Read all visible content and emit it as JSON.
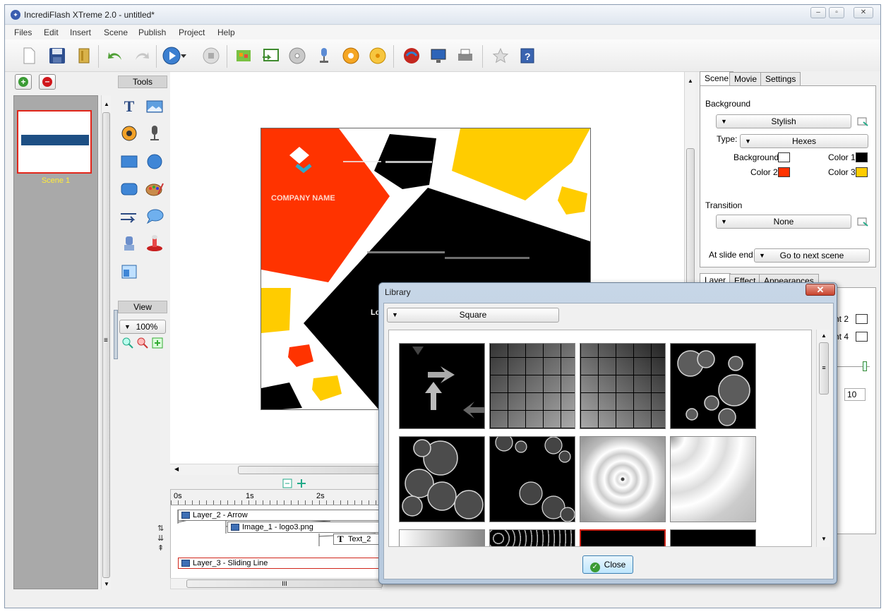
{
  "window": {
    "title": "IncrediFlash XTreme 2.0 - untitled*"
  },
  "menu": [
    "Files",
    "Edit",
    "Insert",
    "Scene",
    "Publish",
    "Project",
    "Help"
  ],
  "scenes": {
    "items": [
      {
        "label": "Scene 1"
      }
    ]
  },
  "tools": {
    "header": "Tools",
    "view_header": "View",
    "zoom": "100%"
  },
  "stage": {
    "company_name": "COMPANY NAME",
    "text_fragment": "Lo"
  },
  "timeline": {
    "ticks": [
      "0s",
      "1s",
      "2s"
    ],
    "layers": [
      {
        "label": "Layer_2 - Arrow"
      },
      {
        "label": "Image_1 - logo3.png"
      },
      {
        "label": "Text_2"
      },
      {
        "label": "Layer_3 - Sliding Line"
      }
    ],
    "scrollbar_grip": "III"
  },
  "right_panel": {
    "tabs_top": [
      "Scene",
      "Movie",
      "Settings"
    ],
    "background_label": "Background",
    "background_style": "Stylish",
    "type_label": "Type:",
    "type_value": "Hexes",
    "color_labels": {
      "background": "Background",
      "color1": "Color 1",
      "color2": "Color 2",
      "color3": "Color 3"
    },
    "colors": {
      "background": "#ffffff",
      "color1": "#000000",
      "color2": "#ff3300",
      "color3": "#ffcc00"
    },
    "transition_label": "Transition",
    "transition_value": "None",
    "slide_end_label": "At slide end:",
    "slide_end_value": "Go to next scene",
    "tabs_bottom": [
      "Layer",
      "Effect",
      "Appearances"
    ],
    "partial_labels": [
      "nt 2",
      "nt 4"
    ],
    "partial_number": "10"
  },
  "library": {
    "title": "Library",
    "category": "Square",
    "close_label": "Close"
  }
}
